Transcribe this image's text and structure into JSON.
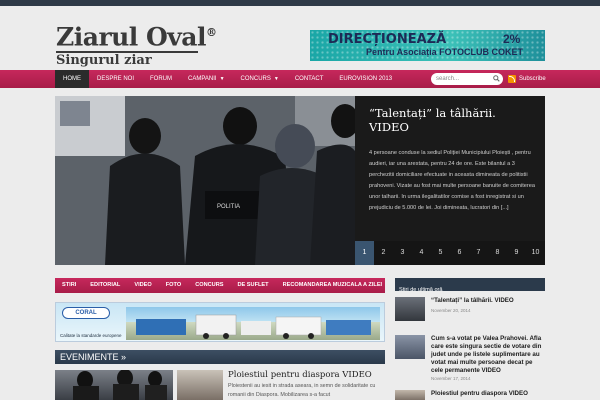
{
  "site": {
    "logo_title": "Ziarul Oval",
    "logo_mark": "®",
    "logo_slogan": "Singurul ziar normal."
  },
  "ad_banner": {
    "headline": "DIRECȚIONEAZĂ",
    "percent": "2%",
    "subline": "Pentru Asociația FOTOCLUB COKET"
  },
  "nav": {
    "items": [
      {
        "label": "Home",
        "active": true
      },
      {
        "label": "Despre noi"
      },
      {
        "label": "Forum"
      },
      {
        "label": "Campanii",
        "dropdown": true
      },
      {
        "label": "Concurs",
        "dropdown": true
      },
      {
        "label": "Contact"
      },
      {
        "label": "Eurovision 2013"
      }
    ],
    "search_placeholder": "search...",
    "subscribe_label": "Subscribe"
  },
  "slider": {
    "title": "“Talentați” la tâlhării. VIDEO",
    "body": "4 persoane conduse la sediul Poliției Municipiului Ploiești , pentru audieri, iar una arestata, pentru 24 de ore. Este bilantul a 3 perchezitii domiciliare efectuate in aceasta dimineata de politistii prahoveni. Vizate au fost mai multe persoane banuite de comiterea unor talharii. In urma ilegalitatilor comise a fost inregistrat si un prejudiciu de 5.000 de lei. Joi dimineata, lucratori din [...]",
    "pages": [
      "1",
      "2",
      "3",
      "4",
      "5",
      "6",
      "7",
      "8",
      "9",
      "10"
    ],
    "active_page": "1",
    "vest_text": "POLITIA"
  },
  "category_tabs": [
    "Stiri",
    "Editorial",
    "Video",
    "Foto",
    "Concurs",
    "De suflet",
    "Recomandarea muzicala a zilei"
  ],
  "coral_ad": {
    "logo": "CORAL",
    "cert": "Calitate la standarde europene"
  },
  "events": {
    "section_title": "EVENIMENTE »",
    "post_title": "Ploiestiul pentru diaspora VIDEO",
    "post_excerpt": "Ploiestenii au iesit in strada aseara, in semn de solidaritate cu romanii din Diaspora. Mobilizarea s-a facut"
  },
  "sidebar": {
    "heading": "Stiri de ultimă oră",
    "posts": [
      {
        "title": "“Talentați” la tâlhării. VIDEO",
        "date": "November 20, 2014"
      },
      {
        "title": "Cum s-a votat pe Valea Prahovei. Afla care este singura sectie de votare din judet unde pe listele suplimentare au votat mai multe persoane decat pe cele permanente VIDEO",
        "date": "November 17, 2014"
      },
      {
        "title": "Ploiestiul pentru diaspora VIDEO",
        "date": ""
      }
    ]
  },
  "colors": {
    "accent": "#b8204f",
    "nav_dark": "#2b2b2b",
    "section_bar": "#2e3d4f"
  }
}
